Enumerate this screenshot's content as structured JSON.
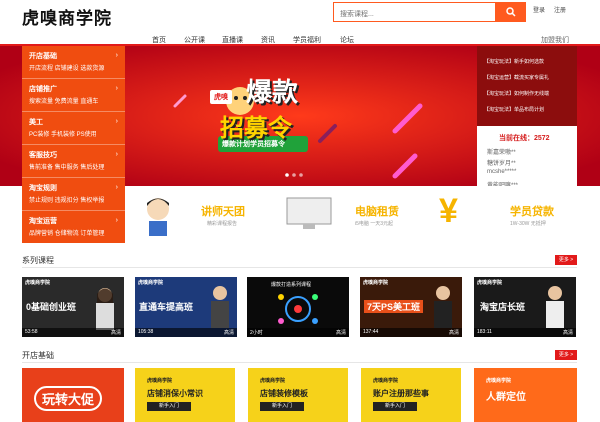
{
  "header": {
    "logo_text": "虎嗅商学院",
    "search_placeholder": "搜索课程...",
    "login_label": "登录",
    "register_label": "注册"
  },
  "nav": {
    "items": [
      "首页",
      "公开课",
      "直播课",
      "资讯",
      "学员福利",
      "论坛"
    ],
    "join_label": "加盟我们"
  },
  "side_menu": [
    {
      "title": "开店基础",
      "subs": "开店流程  店铺建设  选款货源"
    },
    {
      "title": "店铺推广",
      "subs": "搜索流量  免费流量  直通车"
    },
    {
      "title": "美工",
      "subs": "PC装修  手机装修  PS使用"
    },
    {
      "title": "客服技巧",
      "subs": "售前准备  售中服务  售后处理"
    },
    {
      "title": "淘宝规则",
      "subs": "禁止规则  违规扣分  售权举报"
    },
    {
      "title": "淘宝运营",
      "subs": "品牌营销  仓储物流  订单管理"
    }
  ],
  "banner": {
    "badge": "虎嗅",
    "headline_1": "爆款",
    "headline_2": "招募令",
    "ribbon": "爆款计划学员招募令"
  },
  "notice": {
    "news": [
      "【淘宝玩法】新手如何选款",
      "【淘宝运营】截流买家专属礼",
      "【淘宝玩法】如何制作无线端",
      "【淘宝玩法】单品布局计划"
    ],
    "online_label": "当前在线：",
    "online_count": "2572",
    "users": [
      "斯嘉荣嗷**",
      "糖饼岁月**",
      "mcshe*****",
      "黄能吧嘛***"
    ]
  },
  "features": [
    {
      "title": "讲师天团",
      "sub": "精彩课程报告"
    },
    {
      "title": "电脑租赁",
      "sub": "i5电脑 一天3元起"
    },
    {
      "title": "学员贷款",
      "sub": "1W-30W 无抵押"
    }
  ],
  "series": {
    "title": "系列课程",
    "more": "更多 >",
    "courses": [
      {
        "brand": "虎嗅商学院",
        "title": "0基础创业班",
        "duration": "53:58",
        "tag": "高清"
      },
      {
        "brand": "虎嗅商学院",
        "title": "直通车提高班",
        "duration": "105:38",
        "tag": "高清"
      },
      {
        "brand": "",
        "title": "爆款打造系列课程",
        "duration": "2小时",
        "tag": "高清"
      },
      {
        "brand": "虎嗅商学院",
        "title": "7天PS美工班",
        "duration": "137:44",
        "tag": "高清"
      },
      {
        "brand": "虎嗅商学院",
        "title": "淘宝店长班",
        "duration": "183:11",
        "tag": "高清"
      }
    ]
  },
  "basics": {
    "title": "开店基础",
    "more": "更多 >",
    "cards": [
      {
        "brand": "",
        "title": "玩转大促",
        "sub": ""
      },
      {
        "brand": "虎嗅商学院",
        "title": "店铺消保小常识",
        "sub": "新手入门"
      },
      {
        "brand": "虎嗅商学院",
        "title": "店铺装修模板",
        "sub": "新手入门"
      },
      {
        "brand": "虎嗅商学院",
        "title": "账户注册那些事",
        "sub": "新手入门"
      },
      {
        "brand": "虎嗅商学院",
        "title": "人群定位",
        "sub": ""
      }
    ]
  },
  "colors": {
    "accent": "#e21a1a",
    "orange": "#ff5a1f",
    "gold": "#f6b400"
  }
}
